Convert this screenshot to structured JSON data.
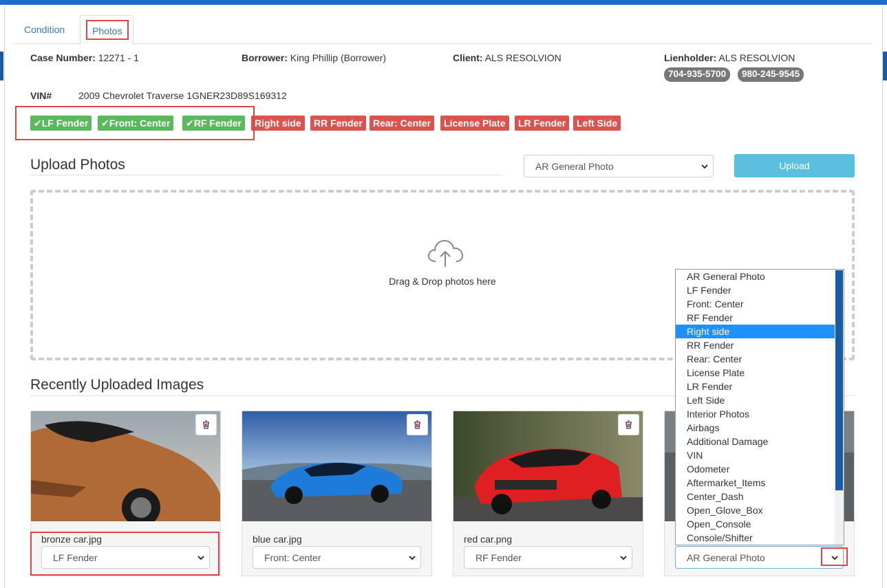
{
  "tabs": [
    {
      "label": "Condition"
    },
    {
      "label": "Photos"
    }
  ],
  "case": {
    "case_number_label": "Case Number:",
    "case_number": "12271 - 1",
    "borrower_label": "Borrower:",
    "borrower": "King Phillip (Borrower)",
    "client_label": "Client:",
    "client": "ALS RESOLVION",
    "lienholder_label": "Lienholder:",
    "lienholder": "ALS RESOLVION",
    "phones": [
      "704-935-5700",
      "980-245-9545"
    ],
    "vin_label": "VIN#",
    "vin": "2009 Chevrolet Traverse 1GNER23D89S169312"
  },
  "badges": [
    {
      "label": "LF Fender",
      "done": true
    },
    {
      "label": "Front: Center",
      "done": true
    },
    {
      "label": "RF Fender",
      "done": true
    },
    {
      "label": "Right side",
      "done": false
    },
    {
      "label": "RR Fender",
      "done": false
    },
    {
      "label": "Rear: Center",
      "done": false
    },
    {
      "label": "License Plate",
      "done": false
    },
    {
      "label": "LR Fender",
      "done": false
    },
    {
      "label": "Left Side",
      "done": false
    }
  ],
  "colors": {
    "done": "#5cb85c",
    "missing": "#d9534f",
    "accent": "#337ab7",
    "upload_button": "#5bc0de",
    "highlight": "#e04444"
  },
  "upload": {
    "title": "Upload Photos",
    "type_value": "AR General Photo",
    "button_label": "Upload",
    "drop_text": "Drag & Drop photos here"
  },
  "recent": {
    "title": "Recently Uploaded Images",
    "cards": [
      {
        "filename": "bronze car.jpg",
        "type": "LF Fender"
      },
      {
        "filename": "blue car.jpg",
        "type": "Front: Center"
      },
      {
        "filename": "red car.png",
        "type": "RF Fender"
      },
      {
        "filename": "",
        "type": "AR General Photo"
      }
    ]
  },
  "dropdown": {
    "selected": "Right side",
    "options": [
      "AR General Photo",
      "LF Fender",
      "Front: Center",
      "RF Fender",
      "Right side",
      "RR Fender",
      "Rear: Center",
      "License Plate",
      "LR Fender",
      "Left Side",
      "Interior Photos",
      "Airbags",
      "Additional Damage",
      "VIN",
      "Odometer",
      "Aftermarket_Items",
      "Center_Dash",
      "Open_Glove_Box",
      "Open_Console",
      "Console/Shifter"
    ]
  }
}
